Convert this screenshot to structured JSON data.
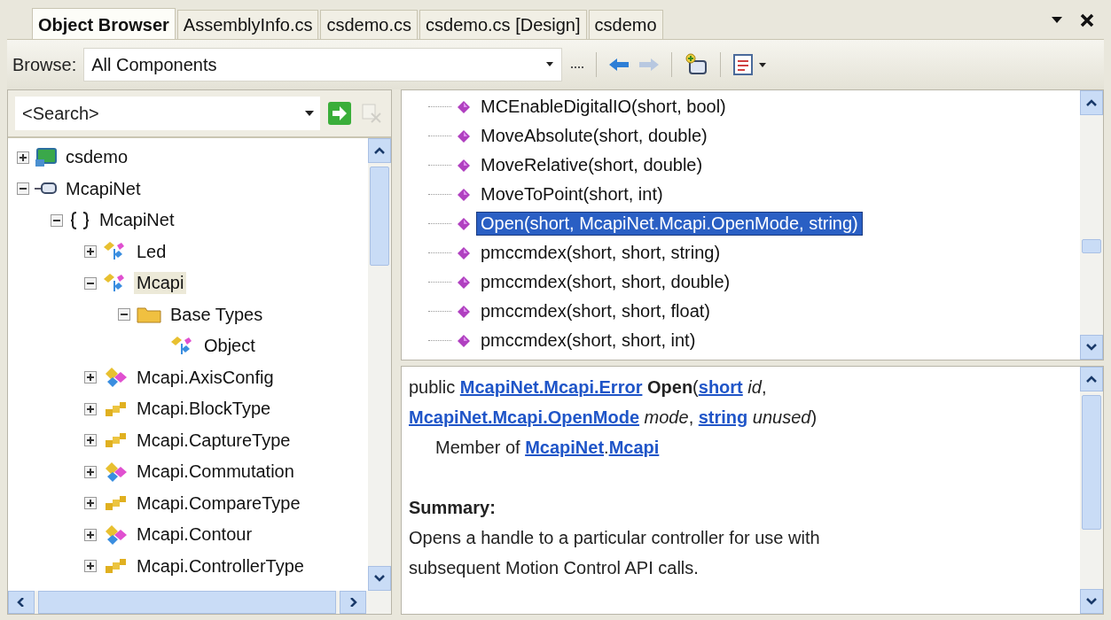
{
  "tabs": [
    {
      "label": "Object Browser",
      "selected": true
    },
    {
      "label": "AssemblyInfo.cs",
      "selected": false
    },
    {
      "label": "csdemo.cs",
      "selected": false
    },
    {
      "label": "csdemo.cs [Design]",
      "selected": false
    },
    {
      "label": "csdemo",
      "selected": false
    }
  ],
  "toolbar": {
    "browse_label": "Browse:",
    "scope": "All Components",
    "forward_disabled": true
  },
  "search": {
    "placeholder": "<Search>",
    "clear_disabled": true
  },
  "tree": [
    {
      "label": "csdemo",
      "kind": "project",
      "expanded": false,
      "selected": false
    },
    {
      "label": "McapiNet",
      "kind": "assembly",
      "expanded": true,
      "selected": false,
      "children": [
        {
          "label": "McapiNet",
          "kind": "namespace",
          "expanded": true,
          "selected": false,
          "children": [
            {
              "label": "Led",
              "kind": "class",
              "expanded": false,
              "selected": false
            },
            {
              "label": "Mcapi",
              "kind": "class",
              "expanded": true,
              "selected": true,
              "children": [
                {
                  "label": "Base Types",
                  "kind": "folder",
                  "expanded": true,
                  "selected": false,
                  "children": [
                    {
                      "label": "Object",
                      "kind": "class",
                      "selected": false
                    }
                  ]
                }
              ]
            },
            {
              "label": "Mcapi.AxisConfig",
              "kind": "struct",
              "expanded": false,
              "selected": false
            },
            {
              "label": "Mcapi.BlockType",
              "kind": "enum",
              "expanded": false,
              "selected": false
            },
            {
              "label": "Mcapi.CaptureType",
              "kind": "enum",
              "expanded": false,
              "selected": false
            },
            {
              "label": "Mcapi.Commutation",
              "kind": "struct",
              "expanded": false,
              "selected": false
            },
            {
              "label": "Mcapi.CompareType",
              "kind": "enum",
              "expanded": false,
              "selected": false
            },
            {
              "label": "Mcapi.Contour",
              "kind": "struct",
              "expanded": false,
              "selected": false
            },
            {
              "label": "Mcapi.ControllerType",
              "kind": "enum",
              "expanded": false,
              "selected": false
            }
          ]
        }
      ]
    }
  ],
  "members": [
    {
      "label": "MCEnableDigitalIO(short, bool)",
      "selected": false
    },
    {
      "label": "MoveAbsolute(short, double)",
      "selected": false
    },
    {
      "label": "MoveRelative(short, double)",
      "selected": false
    },
    {
      "label": "MoveToPoint(short, int)",
      "selected": false
    },
    {
      "label": "Open(short, McapiNet.Mcapi.OpenMode, string)",
      "selected": true
    },
    {
      "label": "pmccmdex(short, short, string)",
      "selected": false
    },
    {
      "label": "pmccmdex(short, short, double)",
      "selected": false
    },
    {
      "label": "pmccmdex(short, short, float)",
      "selected": false
    },
    {
      "label": "pmccmdex(short, short, int)",
      "selected": false
    }
  ],
  "description": {
    "signature": [
      [
        {
          "kind": "text",
          "text": "public "
        },
        {
          "kind": "link",
          "text": "McapiNet.Mcapi.Error"
        },
        {
          "kind": "bold",
          "text": " Open"
        },
        {
          "kind": "text",
          "text": "("
        },
        {
          "kind": "link",
          "text": "short"
        },
        {
          "kind": "italic",
          "text": " id"
        },
        {
          "kind": "text",
          "text": ","
        }
      ],
      [
        {
          "kind": "link",
          "text": "McapiNet.Mcapi.OpenMode"
        },
        {
          "kind": "italic",
          "text": " mode"
        },
        {
          "kind": "text",
          "text": ", "
        },
        {
          "kind": "link",
          "text": "string"
        },
        {
          "kind": "italic",
          "text": " unused"
        },
        {
          "kind": "text",
          "text": ")"
        }
      ]
    ],
    "member_of": [
      {
        "kind": "text",
        "text": "Member of "
      },
      {
        "kind": "link",
        "text": "McapiNet"
      },
      {
        "kind": "text",
        "text": "."
      },
      {
        "kind": "link",
        "text": "Mcapi"
      }
    ],
    "summary_heading": "Summary:",
    "summary": "Opens a handle to a particular controller for use with subsequent Motion Control API calls."
  }
}
